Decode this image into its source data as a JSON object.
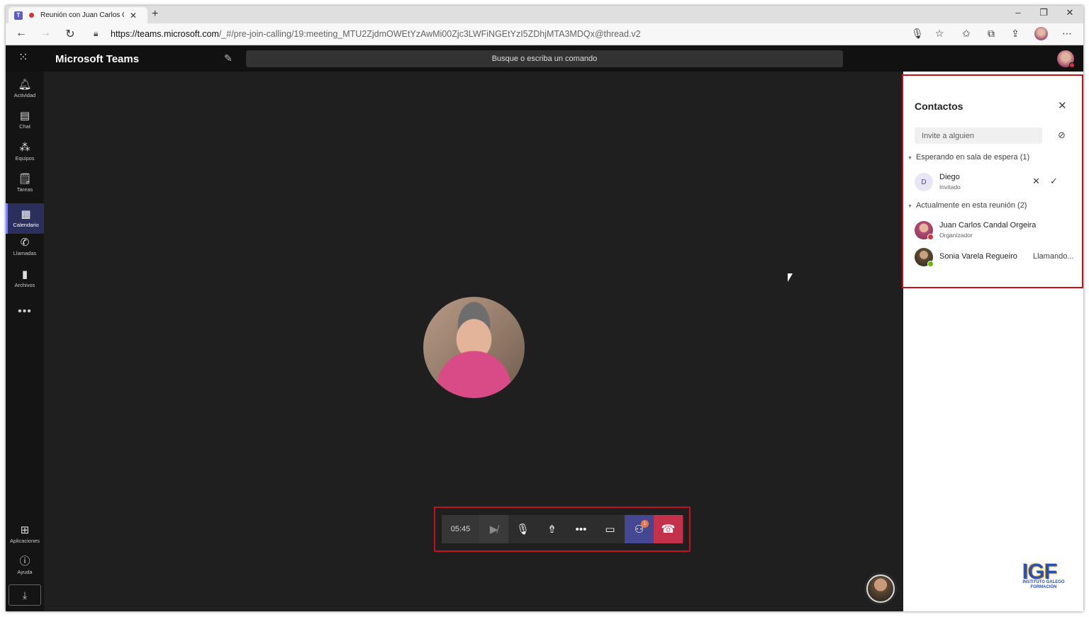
{
  "browser": {
    "tab_title": "Reunión con Juan Carlos Ca",
    "url_host": "https://teams.microsoft.com",
    "url_path": "/_#/pre-join-calling/19:meeting_MTU2ZjdmOWEtYzAwMi00Zjc3LWFiNGEtYzI5ZDhjMTA3MDQx@thread.v2"
  },
  "teams": {
    "app_name": "Microsoft Teams",
    "search_placeholder": "Busque o escriba un comando"
  },
  "rail": {
    "items": [
      {
        "label": "Actividad",
        "icon": "bell-icon"
      },
      {
        "label": "Chat",
        "icon": "chat-icon"
      },
      {
        "label": "Equipos",
        "icon": "teams-icon"
      },
      {
        "label": "Tareas",
        "icon": "tasks-icon"
      },
      {
        "label": "Calendario",
        "icon": "calendar-icon",
        "active": true
      },
      {
        "label": "Llamadas",
        "icon": "phone-icon"
      },
      {
        "label": "Archivos",
        "icon": "files-icon"
      }
    ],
    "apps_label": "Aplicaciones",
    "help_label": "Ayuda"
  },
  "call": {
    "timer": "05:45",
    "participants_badge": "1"
  },
  "panel": {
    "title": "Contactos",
    "invite_placeholder": "Invite a alguien",
    "waiting_section": "Esperando en sala de espera (1)",
    "waiting": [
      {
        "initial": "D",
        "name": "Diego",
        "role": "Invitado"
      }
    ],
    "current_section": "Actualmente en esta reunión (2)",
    "current": [
      {
        "name": "Juan Carlos Candal Orgeira",
        "role": "Organizador",
        "status_color": "#d13438"
      },
      {
        "name": "Sonia Varela Regueiro",
        "status_text": "Llamando...",
        "status_color": "#6bb700"
      }
    ]
  },
  "logo": {
    "text": "IGF",
    "subtitle_line1": "INSTITUTO GALEGO",
    "subtitle_line2": "FORMACIÓN"
  },
  "colors": {
    "accent": "#444791",
    "hangup": "#c4314b",
    "focus_outline": "#c50f1f"
  }
}
